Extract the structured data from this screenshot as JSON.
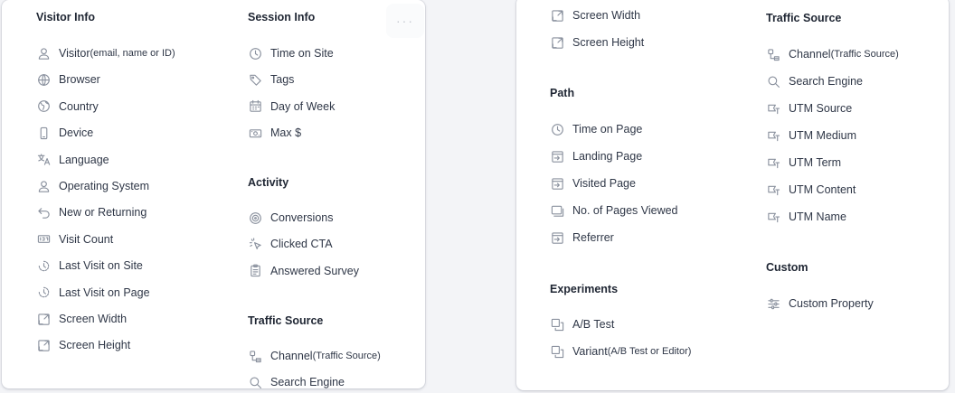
{
  "left_panel": {
    "more_label": "···",
    "visitor_info": {
      "title": "Visitor Info",
      "items": [
        {
          "label": "Visitor",
          "suffix": "(email, name or ID)",
          "icon": "user-icon"
        },
        {
          "label": "Browser",
          "icon": "globe-icon"
        },
        {
          "label": "Country",
          "icon": "earth-icon"
        },
        {
          "label": "Device",
          "icon": "phone-icon"
        },
        {
          "label": "Language",
          "icon": "translate-icon"
        },
        {
          "label": "Operating System",
          "icon": "user-icon"
        },
        {
          "label": "New or Returning",
          "icon": "return-arrow-icon"
        },
        {
          "label": "Visit Count",
          "icon": "counter-icon"
        },
        {
          "label": "Last Visit on Site",
          "icon": "history-clock-icon"
        },
        {
          "label": "Last Visit on Page",
          "icon": "history-clock-icon"
        },
        {
          "label": "Screen Width",
          "icon": "resize-icon"
        },
        {
          "label": "Screen Height",
          "icon": "resize-icon"
        }
      ]
    },
    "session_info": {
      "title": "Session Info",
      "items": [
        {
          "label": "Time on Site",
          "icon": "clock-icon"
        },
        {
          "label": "Tags",
          "icon": "tag-icon"
        },
        {
          "label": "Day of Week",
          "icon": "calendar-icon"
        },
        {
          "label": "Max $",
          "icon": "money-icon"
        }
      ]
    },
    "activity": {
      "title": "Activity",
      "items": [
        {
          "label": "Conversions",
          "icon": "target-icon"
        },
        {
          "label": "Clicked CTA",
          "icon": "cursor-click-icon"
        },
        {
          "label": "Answered Survey",
          "icon": "clipboard-icon"
        }
      ]
    },
    "traffic_source": {
      "title": "Traffic Source",
      "items": [
        {
          "label": "Channel",
          "suffix": "(Traffic Source)",
          "icon": "channel-icon"
        },
        {
          "label": "Search Engine",
          "icon": "search-icon"
        }
      ]
    }
  },
  "right_panel": {
    "top_items": [
      {
        "label": "Screen Width",
        "icon": "resize-icon"
      },
      {
        "label": "Screen Height",
        "icon": "resize-icon"
      }
    ],
    "path": {
      "title": "Path",
      "items": [
        {
          "label": "Time on Page",
          "icon": "clock-icon"
        },
        {
          "label": "Landing Page",
          "icon": "page-enter-icon"
        },
        {
          "label": "Visited Page",
          "icon": "page-enter-icon"
        },
        {
          "label": "No. of Pages Viewed",
          "icon": "pages-icon"
        },
        {
          "label": "Referrer",
          "icon": "page-enter-icon"
        }
      ]
    },
    "experiments": {
      "title": "Experiments",
      "items": [
        {
          "label": "A/B Test",
          "icon": "copy-icon"
        },
        {
          "label": "Variant",
          "suffix": "(A/B Test or Editor)",
          "icon": "copy-icon"
        }
      ]
    },
    "traffic_source": {
      "title": "Traffic Source",
      "items": [
        {
          "label": "Channel",
          "suffix": "(Traffic Source)",
          "icon": "channel-icon"
        },
        {
          "label": "Search Engine",
          "icon": "search-icon"
        },
        {
          "label": "UTM Source",
          "icon": "utm-flag-icon"
        },
        {
          "label": "UTM Medium",
          "icon": "utm-flag-icon"
        },
        {
          "label": "UTM Term",
          "icon": "utm-flag-icon"
        },
        {
          "label": "UTM Content",
          "icon": "utm-flag-icon"
        },
        {
          "label": "UTM Name",
          "icon": "utm-flag-icon"
        }
      ]
    },
    "custom": {
      "title": "Custom",
      "items": [
        {
          "label": "Custom Property",
          "icon": "sliders-icon"
        }
      ]
    }
  },
  "colors": {
    "icon": "#8a919e",
    "text": "#2f3747",
    "heading": "#1f2633",
    "panel_bg": "#ffffff",
    "page_bg": "#f3f4f7"
  }
}
